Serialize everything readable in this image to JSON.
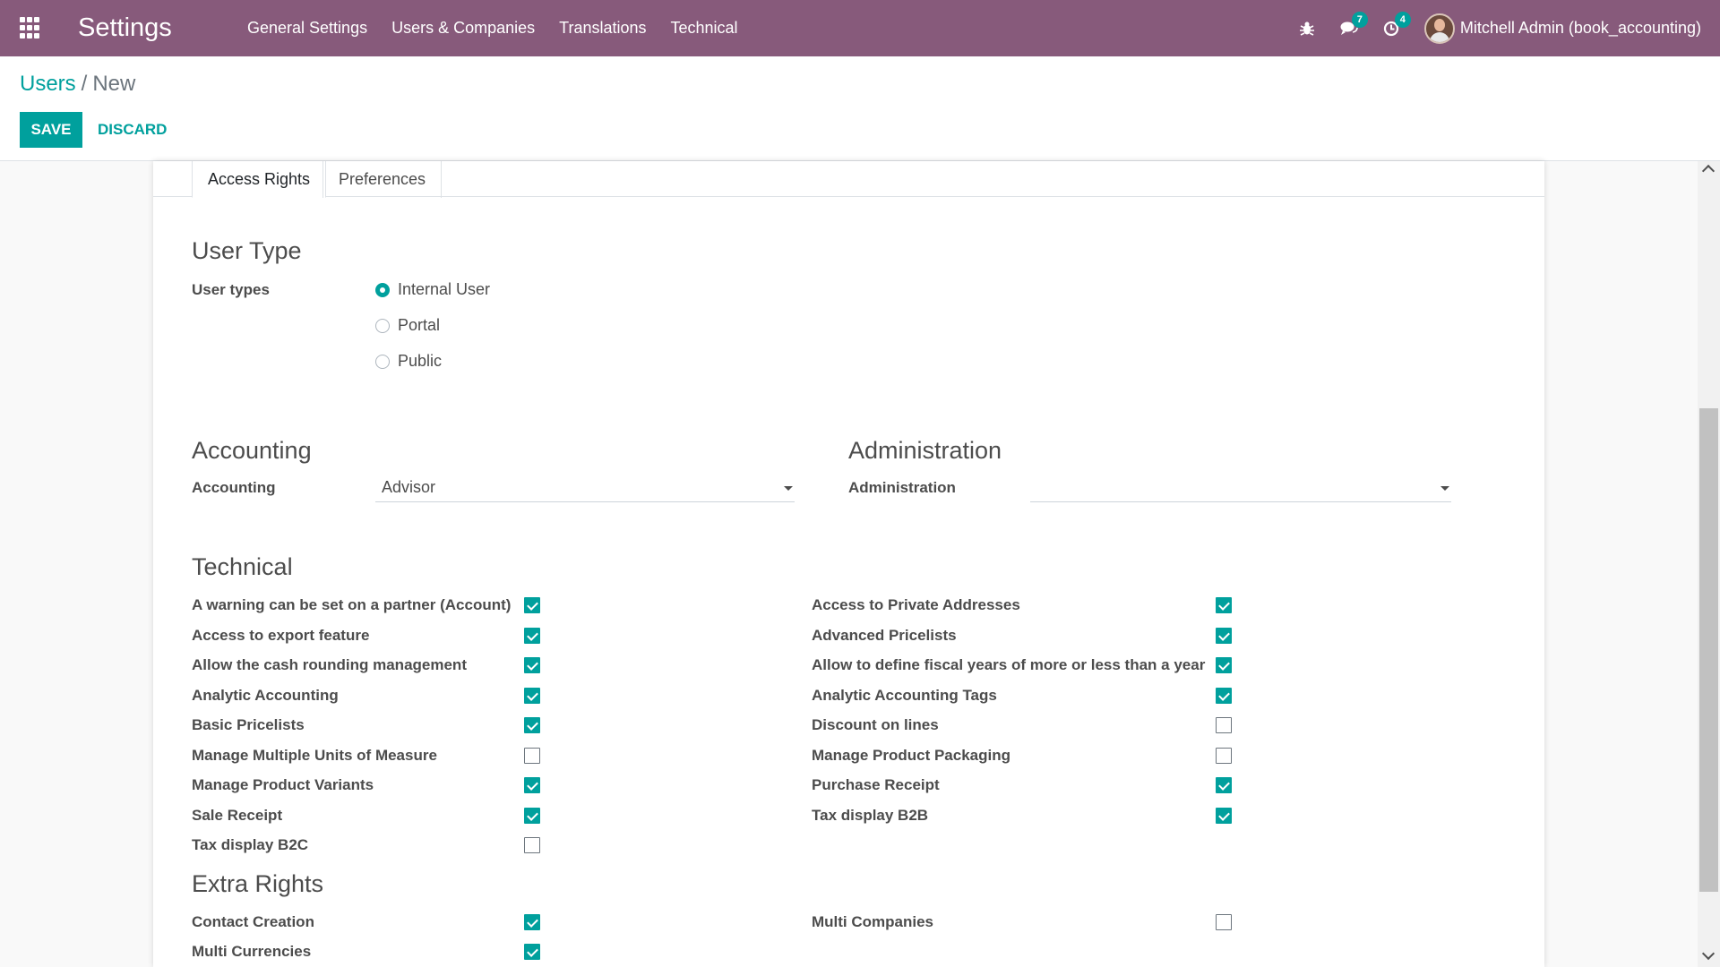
{
  "navbar": {
    "app_title": "Settings",
    "menu": [
      "General Settings",
      "Users & Companies",
      "Translations",
      "Technical"
    ],
    "chat_count": "7",
    "activity_count": "4",
    "user_name": "Mitchell Admin (book_accounting)",
    "icons": [
      "apps-icon",
      "bug-icon",
      "chat-icon",
      "clock-icon",
      "avatar"
    ]
  },
  "breadcrumb": {
    "parent": "Users",
    "separator": "/",
    "current": "New"
  },
  "buttons": {
    "save": "SAVE",
    "discard": "DISCARD"
  },
  "tabs": {
    "access_rights": "Access Rights",
    "preferences": "Preferences",
    "active": "Access Rights"
  },
  "user_type": {
    "title": "User Type",
    "label": "User types",
    "options": [
      "Internal User",
      "Portal",
      "Public"
    ],
    "selected": "Internal User"
  },
  "accounting": {
    "title": "Accounting",
    "label": "Accounting",
    "value": "Advisor"
  },
  "administration": {
    "title": "Administration",
    "label": "Administration",
    "value": ""
  },
  "technical": {
    "title": "Technical",
    "left": [
      {
        "label": "A warning can be set on a partner (Account)",
        "checked": true
      },
      {
        "label": "Access to export feature",
        "checked": true
      },
      {
        "label": "Allow the cash rounding management",
        "checked": true
      },
      {
        "label": "Analytic Accounting",
        "checked": true
      },
      {
        "label": "Basic Pricelists",
        "checked": true
      },
      {
        "label": "Manage Multiple Units of Measure",
        "checked": false
      },
      {
        "label": "Manage Product Variants",
        "checked": true
      },
      {
        "label": "Sale Receipt",
        "checked": true
      },
      {
        "label": "Tax display B2C",
        "checked": false
      }
    ],
    "right": [
      {
        "label": "Access to Private Addresses",
        "checked": true
      },
      {
        "label": "Advanced Pricelists",
        "checked": true
      },
      {
        "label": "Allow to define fiscal years of more or less than a year",
        "checked": true
      },
      {
        "label": "Analytic Accounting Tags",
        "checked": true
      },
      {
        "label": "Discount on lines",
        "checked": false
      },
      {
        "label": "Manage Product Packaging",
        "checked": false
      },
      {
        "label": "Purchase Receipt",
        "checked": true
      },
      {
        "label": "Tax display B2B",
        "checked": true
      }
    ]
  },
  "extra_rights": {
    "title": "Extra Rights",
    "left": [
      {
        "label": "Contact Creation",
        "checked": true
      },
      {
        "label": "Multi Currencies",
        "checked": true
      }
    ],
    "right": [
      {
        "label": "Multi Companies",
        "checked": false
      }
    ]
  },
  "colors": {
    "navbar": "#875a7b",
    "accent": "#00a09d",
    "text": "#4c4c4c"
  }
}
